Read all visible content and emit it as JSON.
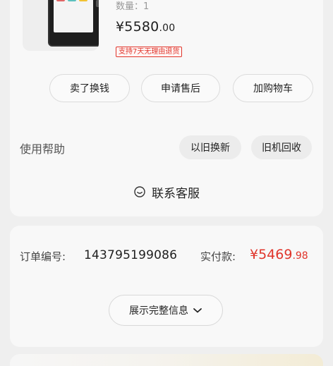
{
  "product": {
    "quantity_label": "数量：1",
    "price_main": "¥5580",
    "price_decimal": ".00",
    "badge": "支持7天无理由退货"
  },
  "actions": {
    "sell": "卖了换钱",
    "after_sale": "申请售后",
    "add_cart": "加购物车"
  },
  "help": {
    "label": "使用帮助",
    "trade_in": "以旧换新",
    "recycle": "旧机回收"
  },
  "service": {
    "label": "联系客服",
    "icon": "chat-smile-icon"
  },
  "order": {
    "number_label": "订单编号:",
    "number": "143795199086",
    "paid_label": "实付款:",
    "paid_main": "¥5469",
    "paid_decimal": ".98",
    "expand_label": "展示完整信息",
    "expand_icon": "chevron-down-icon"
  },
  "colors": {
    "accent_red": "#e0352b",
    "card_bg": "#f8f8f8",
    "page_bg": "#efefef"
  }
}
